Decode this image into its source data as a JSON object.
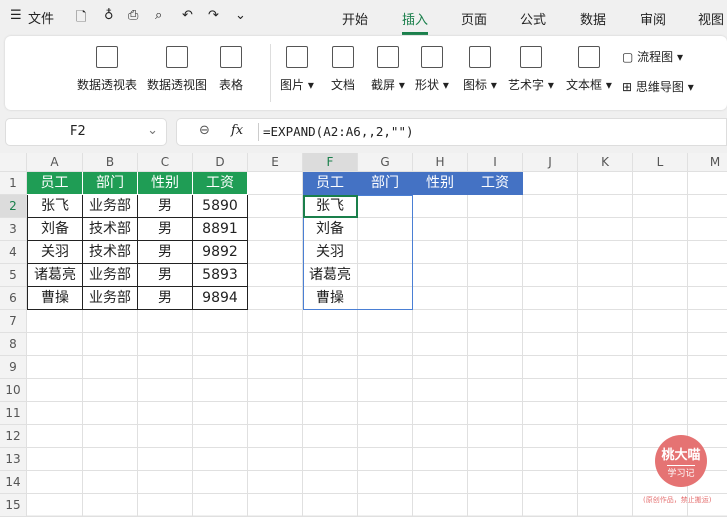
{
  "toolbar": {
    "menu": "文件",
    "menu_icon": "menu-icon"
  },
  "tabs": [
    "开始",
    "插入",
    "页面",
    "公式",
    "数据",
    "审阅",
    "视图"
  ],
  "active_tab": "插入",
  "ribbon": [
    {
      "label": "数据透视表",
      "icon": "pivot-table-icon"
    },
    {
      "label": "数据透视图",
      "icon": "pivot-chart-icon"
    },
    {
      "label": "表格",
      "icon": "table-icon"
    },
    {
      "label": "图片",
      "icon": "picture-icon",
      "dropdown": true
    },
    {
      "label": "文档",
      "icon": "document-icon"
    },
    {
      "label": "截屏",
      "icon": "screenshot-icon",
      "dropdown": true
    },
    {
      "label": "形状",
      "icon": "shape-icon",
      "dropdown": true
    },
    {
      "label": "图标",
      "icon": "icons-icon",
      "dropdown": true
    },
    {
      "label": "艺术字",
      "icon": "wordart-icon",
      "dropdown": true
    },
    {
      "label": "文本框",
      "icon": "textbox-icon",
      "dropdown": true
    }
  ],
  "ribbon_small": [
    {
      "label": "流程图"
    },
    {
      "label": "思维导图"
    }
  ],
  "name_box": "F2",
  "formula": "=EXPAND(A2:A6,,2,\"\")",
  "fx": "fx",
  "columns": [
    "A",
    "B",
    "C",
    "D",
    "E",
    "F",
    "G",
    "H",
    "I",
    "J",
    "K",
    "L",
    "M"
  ],
  "rows": [
    "1",
    "2",
    "3",
    "4",
    "5",
    "6",
    "7",
    "8",
    "9",
    "10",
    "11",
    "12",
    "13",
    "14",
    "15"
  ],
  "table": {
    "headers": [
      "员工",
      "部门",
      "性别",
      "工资"
    ],
    "rows": [
      [
        "张飞",
        "业务部",
        "男",
        "5890"
      ],
      [
        "刘备",
        "技术部",
        "男",
        "8891"
      ],
      [
        "关羽",
        "技术部",
        "男",
        "9892"
      ],
      [
        "诸葛亮",
        "业务部",
        "男",
        "5893"
      ],
      [
        "曹操",
        "业务部",
        "男",
        "9894"
      ]
    ]
  },
  "result": {
    "headers": [
      "员工",
      "部门",
      "性别",
      "工资"
    ],
    "values": [
      "张飞",
      "刘备",
      "关羽",
      "诸葛亮",
      "曹操"
    ]
  },
  "colors": {
    "green_header": "#1f9d55",
    "blue_header": "#4472c4",
    "accent": "#1a7f4b"
  },
  "watermark": {
    "title": "桃大喵",
    "sub": "学习记",
    "note": "(原创作品，禁止搬运)"
  }
}
